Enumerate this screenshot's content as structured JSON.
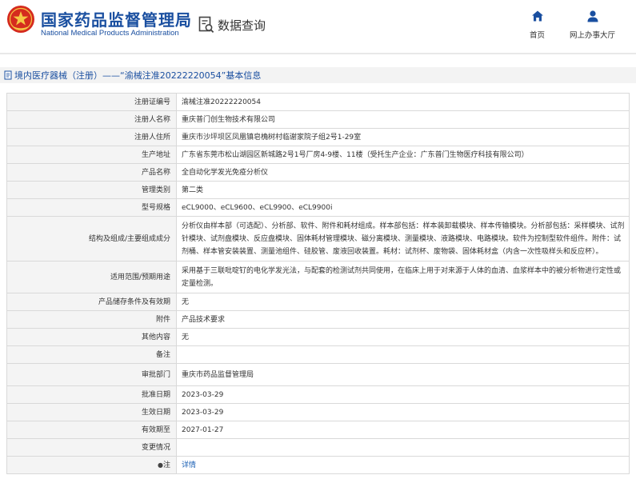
{
  "header": {
    "org_name_cn": "国家药品监督管理局",
    "org_name_en": "National Medical Products Administration",
    "query_label": "数据查询",
    "nav": [
      {
        "label": "首页",
        "icon": "home-icon"
      },
      {
        "label": "网上办事大厅",
        "icon": "user-icon"
      }
    ]
  },
  "title": {
    "text": "境内医疗器械（注册）——“渝械注准20222220054”基本信息"
  },
  "table": {
    "rows": [
      {
        "label": "注册证编号",
        "value": "渝械注准20222220054"
      },
      {
        "label": "注册人名称",
        "value": "重庆普门创生物技术有限公司"
      },
      {
        "label": "注册人住所",
        "value": "重庆市沙坪坝区凤凰镇皂桷树村临谢家院子组2号1-29室"
      },
      {
        "label": "生产地址",
        "value": "广东省东莞市松山湖园区新城路2号1号厂房4-9楼、11楼（受托生产企业：广东普门生物医疗科技有限公司）"
      },
      {
        "label": "产品名称",
        "value": "全自动化学发光免疫分析仪"
      },
      {
        "label": "管理类别",
        "value": "第二类"
      },
      {
        "label": "型号规格",
        "value": "eCL9000、eCL9600、eCL9900、eCL9900i"
      },
      {
        "label": "结构及组成/主要组成成分",
        "value": "分析仪由样本部（可选配）、分析部、软件、附件和耗材组成。样本部包括：样本装卸载模块、样本传输模块。分析部包括：采样模块、试剂针模块、试剂盘模块、反应盘模块、固体耗材管理模块、磁分离模块、测量模块、液路模块、电路模块。软件为控制型软件组件。附件：试剂桶、样本管安装装置、测量池组件、硅胶管、废液回收装置。耗材：试剂杯、废物袋、固体耗材盒（内含一次性吸样头和反应杯）。"
      },
      {
        "label": "适用范围/预期用途",
        "value": "采用基于三联吡啶钌的电化学发光法，与配套的检测试剂共同使用，在临床上用于对来源于人体的血清、血浆样本中的被分析物进行定性或定量检测。"
      },
      {
        "label": "产品储存条件及有效期",
        "value": "无"
      },
      {
        "label": "附件",
        "value": "产品技术要求"
      },
      {
        "label": "其他内容",
        "value": "无"
      },
      {
        "label": "备注",
        "value": ""
      },
      {
        "label": "审批部门",
        "value": "重庆市药品监督管理局"
      },
      {
        "label": "批准日期",
        "value": "2023-03-29"
      },
      {
        "label": "生效日期",
        "value": "2023-03-29"
      },
      {
        "label": "有效期至",
        "value": "2027-01-27"
      },
      {
        "label": "变更情况",
        "value": ""
      },
      {
        "label": "注",
        "value": "详情"
      }
    ]
  },
  "colors": {
    "brand_blue": "#1a4fa0",
    "logo_red": "#d52b1e",
    "link_blue": "#1a5fb4"
  }
}
